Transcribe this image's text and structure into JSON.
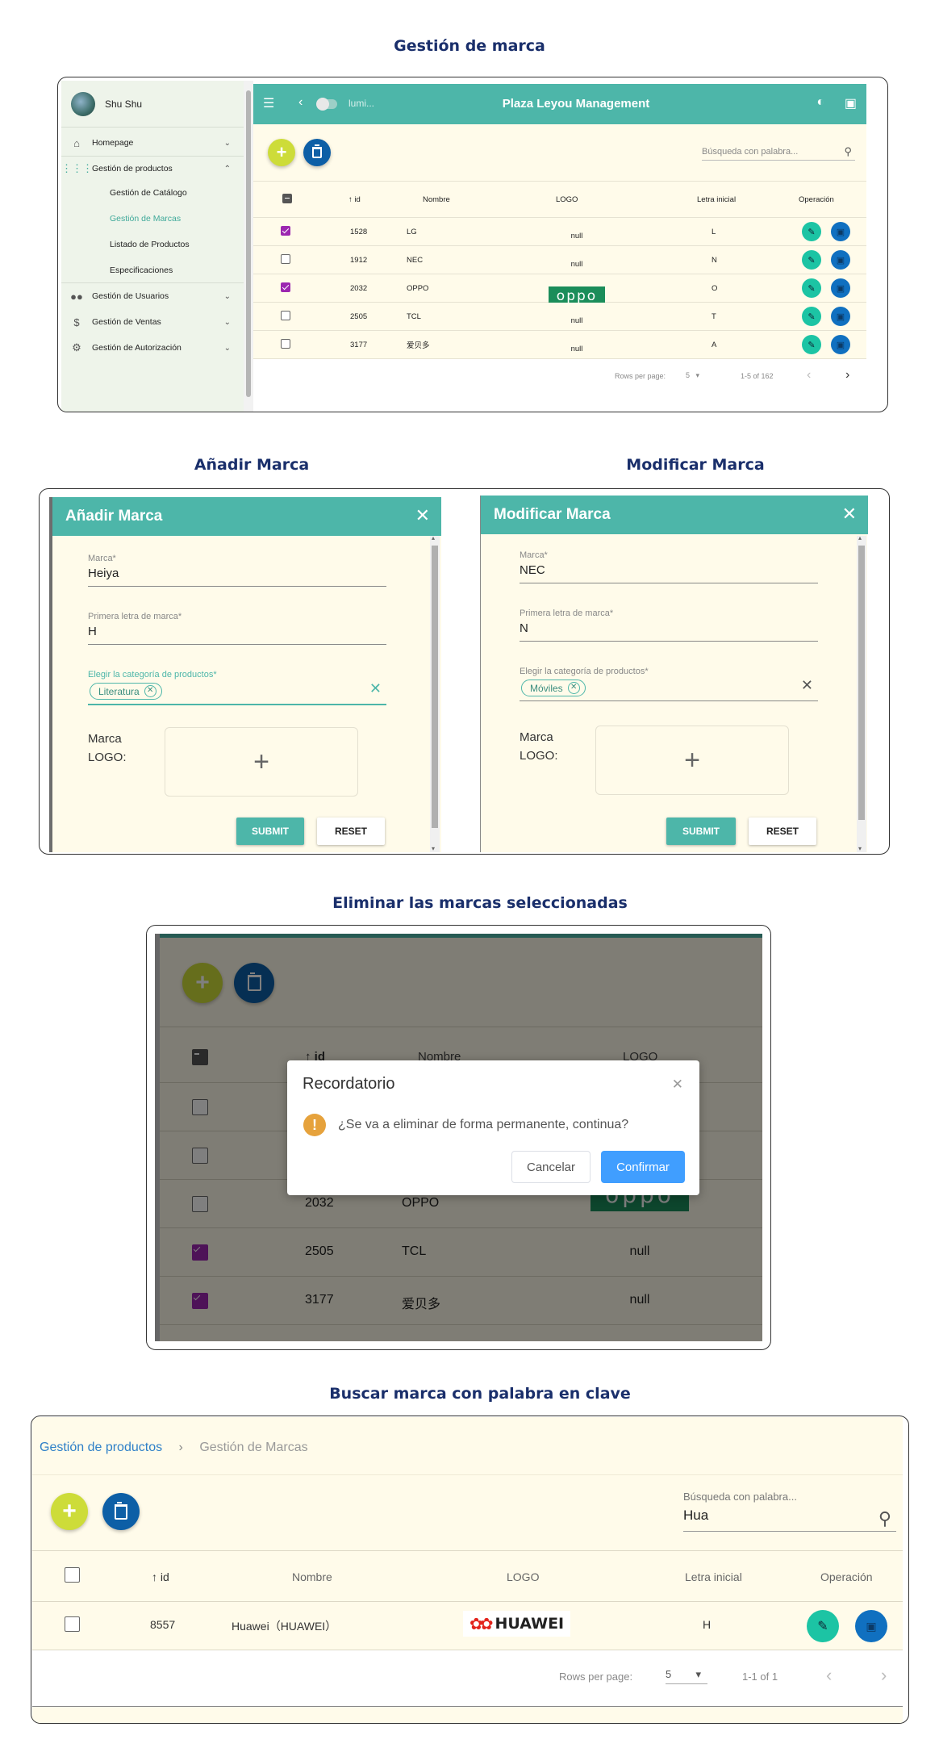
{
  "sections": {
    "main_title": "Gestión de marca",
    "add_title": "Añadir Marca",
    "edit_title": "Modificar Marca",
    "delete_title": "Eliminar las marcas seleccionadas",
    "search_title": "Buscar marca con palabra en clave"
  },
  "app": {
    "title": "Plaza Leyou Management",
    "user": "Shu Shu",
    "theme_label": "lumi...",
    "search_placeholder": "Búsqueda con palabra..."
  },
  "sidebar": {
    "items": [
      {
        "label": "Homepage",
        "icon": "home-icon"
      },
      {
        "label": "Gestión de productos",
        "icon": "apps-icon"
      },
      {
        "label": "Gestión de Usuarios",
        "icon": "people-icon"
      },
      {
        "label": "Gestión de Ventas",
        "icon": "dollar-icon"
      },
      {
        "label": "Gestión de Autorización",
        "icon": "gear-icon"
      }
    ],
    "subitems": [
      "Gestión de Catálogo",
      "Gestión de Marcas",
      "Listado de Productos",
      "Especificaciones"
    ]
  },
  "table": {
    "headers": [
      "id",
      "Nombre",
      "LOGO",
      "Letra inicial",
      "Operación"
    ],
    "rows": [
      {
        "id": "1528",
        "name": "LG",
        "logo": "null",
        "initial": "L",
        "checked": true
      },
      {
        "id": "1912",
        "name": "NEC",
        "logo": "null",
        "initial": "N",
        "checked": false
      },
      {
        "id": "2032",
        "name": "OPPO",
        "logo": "oppo",
        "initial": "O",
        "checked": true
      },
      {
        "id": "2505",
        "name": "TCL",
        "logo": "null",
        "initial": "T",
        "checked": false
      },
      {
        "id": "3177",
        "name": "爱贝多",
        "logo": "null",
        "initial": "A",
        "checked": false
      }
    ],
    "rows_per_page_label": "Rows per page:",
    "rows_per_page": "5",
    "range": "1-5 of 162"
  },
  "add_form": {
    "title": "Añadir Marca",
    "brand_label": "Marca*",
    "brand_value": "Heiya",
    "letter_label": "Primera letra de marca*",
    "letter_value": "H",
    "category_label": "Elegir la categoría de productos*",
    "category_chip": "Literatura",
    "logo_label_1": "Marca",
    "logo_label_2": "LOGO:",
    "submit": "SUBMIT",
    "reset": "RESET"
  },
  "edit_form": {
    "title": "Modificar Marca",
    "brand_label": "Marca*",
    "brand_value": "NEC",
    "letter_label": "Primera letra de marca*",
    "letter_value": "N",
    "category_label": "Elegir la categoría de productos*",
    "category_chip": "Móviles",
    "logo_label_1": "Marca",
    "logo_label_2": "LOGO:",
    "submit": "SUBMIT",
    "reset": "RESET"
  },
  "delete_view": {
    "headers": [
      "id",
      "Nombre",
      "LOGO"
    ],
    "rows": [
      {
        "id": "2032",
        "name": "OPPO",
        "logo": "oppo",
        "checked": false
      },
      {
        "id": "2505",
        "name": "TCL",
        "logo": "null",
        "checked": true
      },
      {
        "id": "3177",
        "name": "爱贝多",
        "logo": "null",
        "checked": true
      }
    ],
    "dialog": {
      "title": "Recordatorio",
      "message": "¿Se va a eliminar de forma permanente, continua?",
      "cancel": "Cancelar",
      "confirm": "Confirmar"
    }
  },
  "search_view": {
    "breadcrumb": [
      "Gestión de productos",
      "Gestión de Marcas"
    ],
    "search_label": "Búsqueda con palabra...",
    "search_value": "Hua",
    "headers": [
      "id",
      "Nombre",
      "LOGO",
      "Letra inicial",
      "Operación"
    ],
    "row": {
      "id": "8557",
      "name": "Huawei（HUAWEI）",
      "logo": "HUAWEI",
      "initial": "H"
    },
    "rows_per_page_label": "Rows per page:",
    "rows_per_page": "5",
    "range": "1-1 of 1"
  },
  "colors": {
    "teal": "#4db6a9",
    "cream": "#fffbea",
    "heading": "#1a2f6b",
    "add_fab": "#cddc39",
    "delete_fab": "#0d5fa6",
    "checkbox": "#9c27b0",
    "confirm": "#409eff"
  }
}
